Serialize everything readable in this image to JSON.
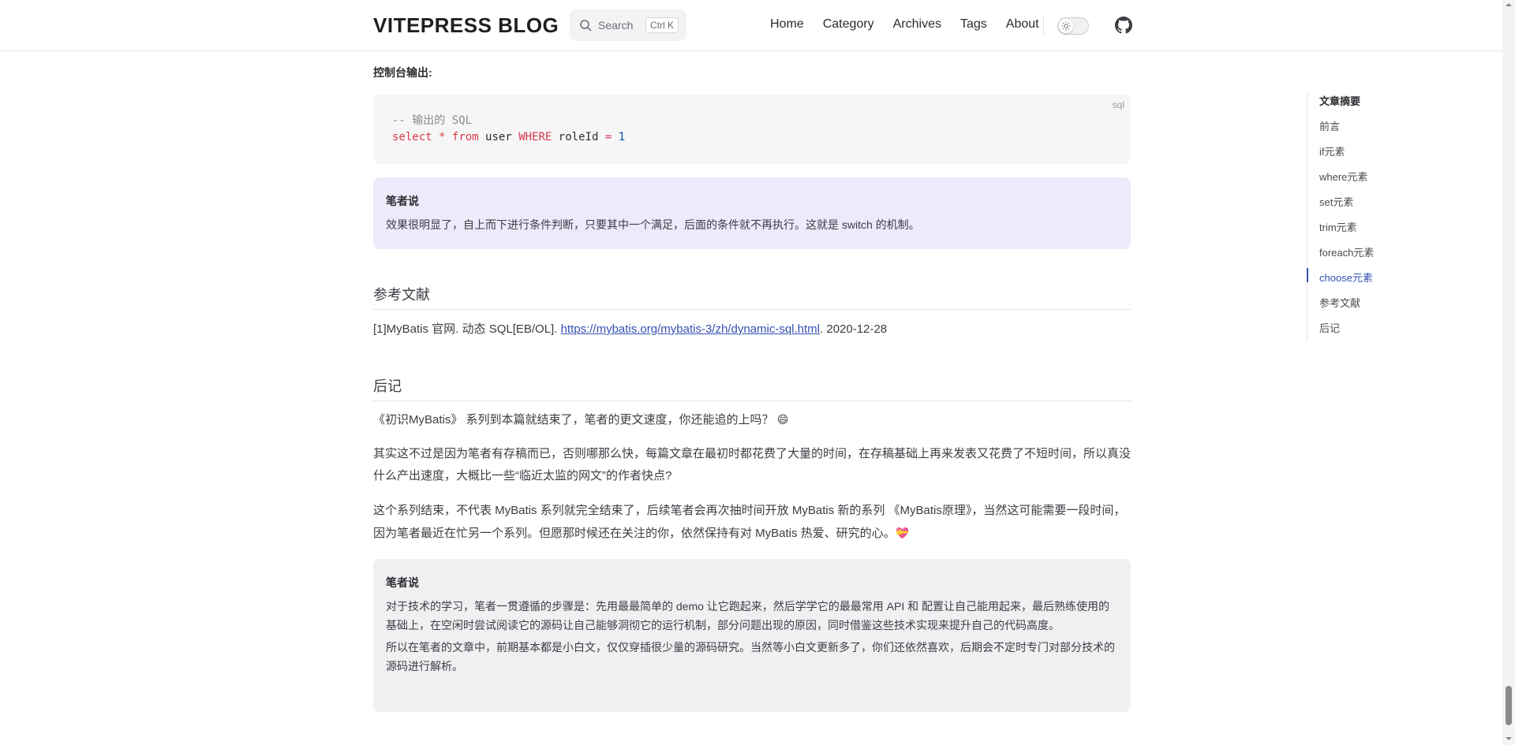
{
  "header": {
    "brand": "VITEPRESS BLOG",
    "search": {
      "label": "Search",
      "shortcut": "Ctrl K"
    },
    "nav": [
      "Home",
      "Category",
      "Archives",
      "Tags",
      "About"
    ]
  },
  "content": {
    "console_label": "控制台输出:",
    "code": {
      "lang": "sql",
      "comment": "-- 输出的 SQL",
      "line": {
        "select": "select",
        "star": "*",
        "from": "from",
        "table": "user",
        "where": "WHERE",
        "column": "roleId",
        "eq": "=",
        "value": "1"
      }
    },
    "tip1": {
      "title": "笔者说",
      "text": "效果很明显了，自上而下进行条件判断，只要其中一个满足，后面的条件就不再执行。这就是 switch 的机制。"
    },
    "refs_heading": "参考文献",
    "ref": {
      "prefix": "[1]MyBatis 官网. 动态 SQL[EB/OL]. ",
      "link": "https://mybatis.org/mybatis-3/zh/dynamic-sql.html",
      "suffix": ". 2020-12-28"
    },
    "after_heading": "后记",
    "p1": "《初识MyBatis》 系列到本篇就结束了，笔者的更文速度，你还能追的上吗？",
    "p1_emoji": "😄",
    "p2": "其实这不过是因为笔者有存稿而已，否则哪那么快，每篇文章在最初时都花费了大量的时间，在存稿基础上再来发表又花费了不短时间，所以真没什么产出速度，大概比一些“临近太监的网文”的作者快点?",
    "p3": "这个系列结束，不代表 MyBatis 系列就完全结束了，后续笔者会再次抽时间开放 MyBatis 新的系列 《MyBatis原理》，当然这可能需要一段时间，因为笔者最近在忙另一个系列。但愿那时候还在关注的你，依然保持有对 MyBatis 热爱、研究的心。",
    "p3_emoji": "💝",
    "tip2": {
      "title": "笔者说",
      "text1": "对于技术的学习，笔者一贯遵循的步骤是：先用最最简单的 demo 让它跑起来，然后学学它的最最常用 API 和 配置让自己能用起来，最后熟练使用的基础上，在空闲时尝试阅读它的源码让自己能够洞彻它的运行机制，部分问题出现的原因，同时借鉴这些技术实现来提升自己的代码高度。",
      "text2": "所以在笔者的文章中，前期基本都是小白文，仅仅穿插很少量的源码研究。当然等小白文更新多了，你们还依然喜欢，后期会不定时专门对部分技术的源码进行解析。"
    }
  },
  "outline": {
    "title": "文章摘要",
    "items": [
      "前言",
      "if元素",
      "where元素",
      "set元素",
      "trim元素",
      "foreach元素",
      "choose元素",
      "参考文献",
      "后记"
    ],
    "active": "choose元素"
  },
  "colors": {
    "accent": "#3451b2",
    "tip_purple_bg": "#ebebfc",
    "tip_gray_bg": "#f0f0f2",
    "code_bg": "#f6f6f7",
    "sql_keyword": "#d73a49",
    "sql_number": "#0550ae"
  }
}
